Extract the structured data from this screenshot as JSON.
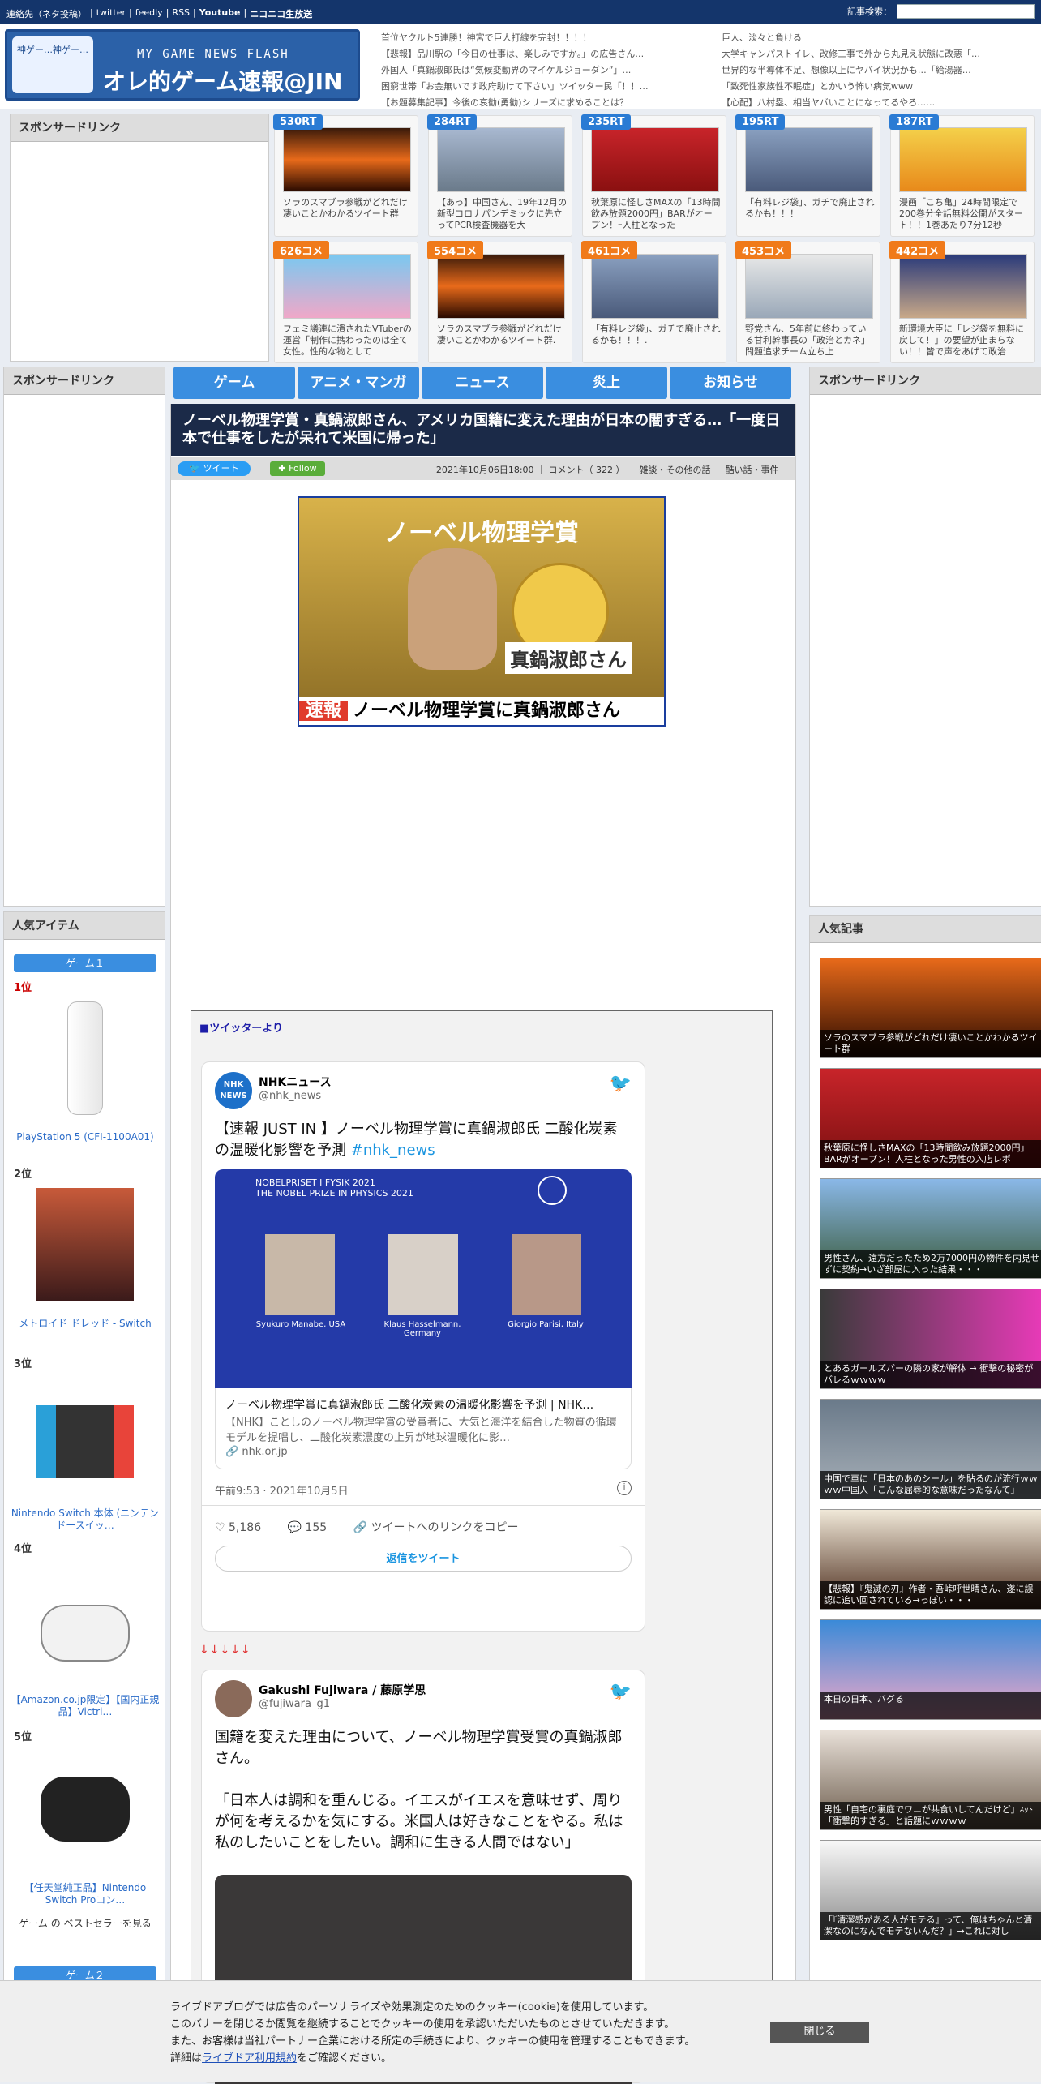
{
  "topbar": {
    "links": [
      "連絡先（ネタ投稿）",
      "|",
      "twitter",
      "|",
      "feedly",
      "|",
      "RSS",
      "|",
      "Youtube",
      "|",
      "ニコニコ生放送"
    ],
    "search_label": "記事検索："
  },
  "logo": {
    "mascot": "神ゲー…神ゲー…",
    "subtitle": "MY GAME NEWS FLASH",
    "title": "オレ的ゲーム速報@JIN"
  },
  "headlines": [
    "首位ヤクルト5連勝！神宮で巨人打線を完封！！！！",
    "巨人、淡々と負ける",
    "【悲報】品川駅の「今日の仕事は、楽しみですか。」の広告さん…",
    "大学キャンパストイレ、改修工事で外から丸見え状態に改悪「…",
    "外国人「真鍋淑郎氏は“気候変動界のマイケルジョーダン”」…",
    "世界的な半導体不足、想像以上にヤバイ状況かも…「給湯器…",
    "困窮世帯「お金無いです政府助けて下さい」ツイッター民「！！…",
    "「致死性家族性不眠症」とかいう怖い病気www",
    "【お題募集記事】今後の哀勧(勇勧)シリーズに求めることは？",
    "【心配】八村塁、相当ヤバいことになってるやろ……"
  ],
  "sponsor_label": "スポンサードリンク",
  "cards": [
    {
      "badge": "530RT",
      "type": "rt",
      "text": "ソラのスマブラ参戦がどれだけ凄いことかわかるツイート群"
    },
    {
      "badge": "284RT",
      "type": "rt",
      "text": "【あっ】中国さん、19年12月の新型コロナパンデミックに先立ってPCR検査機器を大"
    },
    {
      "badge": "235RT",
      "type": "rt",
      "text": "秋葉原に怪しさMAXの「13時間飲み放題2000円」BARがオープン！ｰ人柱となった"
    },
    {
      "badge": "195RT",
      "type": "rt",
      "text": "「有料レジ袋」、ガチで廃止されるかも！！！"
    },
    {
      "badge": "187RT",
      "type": "rt",
      "text": "漫画「こち亀」24時間限定で200巻分全話無料公開がスタート！！1巻あたり7分12秒"
    },
    {
      "badge": "626コメ",
      "type": "cm",
      "text": "フェミ議連に潰されたVTuberの運営「制作に携わったのは全て女性。性的な物として"
    },
    {
      "badge": "554コメ",
      "type": "cm",
      "text": "ソラのスマブラ参戦がどれだけ凄いことかわかるツイート群."
    },
    {
      "badge": "461コメ",
      "type": "cm",
      "text": "「有料レジ袋」、ガチで廃止されるかも！！！."
    },
    {
      "badge": "453コメ",
      "type": "cm",
      "text": "野党さん、5年前に終わっている甘利幹事長の「政治とカネ」問題追求チーム立ち上"
    },
    {
      "badge": "442コメ",
      "type": "cm",
      "text": "新環境大臣に「レジ袋を無料に戻して！」の要望が止まらない！！皆で声をあげて政治"
    }
  ],
  "nav": [
    "ゲーム",
    "アニメ・マンガ",
    "ニュース",
    "炎上",
    "お知らせ"
  ],
  "article": {
    "title": "ノーベル物理学賞・真鍋淑郎さん、アメリカ国籍に変えた理由が日本の闇すぎる…「一度日本で仕事をしたが呆れて米国に帰った」",
    "tweet_btn": "ツイート",
    "follow_btn": "Follow",
    "meta": "2021年10月06日18:00 ｜ コメント（ 322 ） ｜ 雑談・その他の話 ｜ 酷い話・事件 ｜"
  },
  "hero": {
    "heading": "ノーベル物理学賞",
    "name": "真鍋淑郎さん",
    "flash": "速報",
    "caption": "ノーベル物理学賞に真鍋淑郎さん"
  },
  "tweets_label": "■ツイッターより",
  "tweet1": {
    "avatar": "NHK NEWS",
    "name": "NHKニュース",
    "handle": "@nhk_news",
    "text": "【速報 JUST IN 】ノーベル物理学賞に真鍋淑郎氏 二酸化炭素の温暖化影響を予測 ",
    "hashtag": "#nhk_news",
    "img_title": "NOBELPRISET I FYSIK 2021\nTHE NOBEL PRIZE IN PHYSICS 2021",
    "persons": [
      "Syukuro Manabe, USA",
      "Klaus Hasselmann, Germany",
      "Giorgio Parisi, Italy"
    ],
    "link_title": "ノーベル物理学賞に真鍋淑郎氏 二酸化炭素の温暖化影響を予測 | NHK…",
    "link_desc": "【NHK】ことしのノーベル物理学賞の受賞者に、大気と海洋を結合した物質の循環モデルを提唱し、二酸化炭素濃度の上昇が地球温暖化に影…",
    "link_domain": "nhk.or.jp",
    "time": "午前9:53 · 2021年10月5日",
    "likes": "5,186",
    "replies": "155",
    "copy": "ツイートへのリンクをコピー",
    "reply_btn": "返信をツイート"
  },
  "arrows": "↓↓↓↓↓",
  "tweet2": {
    "name": "Gakushi Fujiwara / 藤原学思",
    "handle": "@fujiwara_g1",
    "text1": "国籍を変えた理由について、ノーベル物理学賞受賞の真鍋淑郎さん。",
    "text2": "「日本人は調和を重んじる。イエスがイエスを意味せず、周りが何を考えるかを気にする。米国人は好きなことをやる。私は私のしたいことをしたい。調和に生きる人間ではない」"
  },
  "left_items": {
    "header": "人気アイテム",
    "tab1": "ゲーム１",
    "tab2": "ゲーム２",
    "ranks": [
      "1位",
      "2位",
      "3位",
      "4位",
      "5位"
    ],
    "names": [
      "PlayStation 5 (CFI-1100A01)",
      "メトロイド ドレッド - Switch",
      "Nintendo Switch 本体 (ニンテンドースイッ…",
      "【Amazon.co.jp限定】【国内正規品】Victri…",
      "【任天堂純正品】Nintendo Switch Proコン…"
    ],
    "bestseller": "ゲーム の ベストセラーを見る"
  },
  "right_pop": {
    "header": "人気記事",
    "items": [
      "ソラのスマブラ参戦がどれだけ凄いことかわかるツイート群",
      "秋葉原に怪しさMAXの「13時間飲み放題2000円」BARがオープン！人柱となった男性の入店レポ",
      "男性さん、遠方だったため2万7000円の物件を内見せずに契約→いざ部屋に入った結果・・・",
      "とあるガールズバーの隣の家が解体 → 衝撃の秘密がバレるｗｗｗｗ",
      "中国で車に「日本のあのシール」を貼るのが流行ｗｗｗｗ中国人「こんな屈辱的な意味だったなんて」",
      "【悲報】『鬼滅の刃』作者・吾峠呼世晴さん、遂に誤認に追い回されている→っぽい・・・",
      "本日の日本、バグる",
      "男性「自宅の裏庭でワニが共食いしてんだけど」ﾈｯﾄ「衝撃的すぎる」と話題にｗｗｗｗ",
      "「『清潔感がある人がモテる』って、俺はちゃんと清潔なのになんでモテないんだ？」→これに対し"
    ]
  },
  "cookie": {
    "l1": "ライブドアブログでは広告のパーソナライズや効果測定のためのクッキー(cookie)を使用しています。",
    "l2": "このバナーを閉じるか閲覧を継続することでクッキーの使用を承認いただいたものとさせていただきます。",
    "l3": "また、お客様は当社パートナー企業における所定の手続きにより、クッキーの使用を管理することもできます。",
    "l4a": "詳細は",
    "l4link": "ライブドア利用規約",
    "l4b": "をご確認ください。",
    "close": "閉じる"
  }
}
